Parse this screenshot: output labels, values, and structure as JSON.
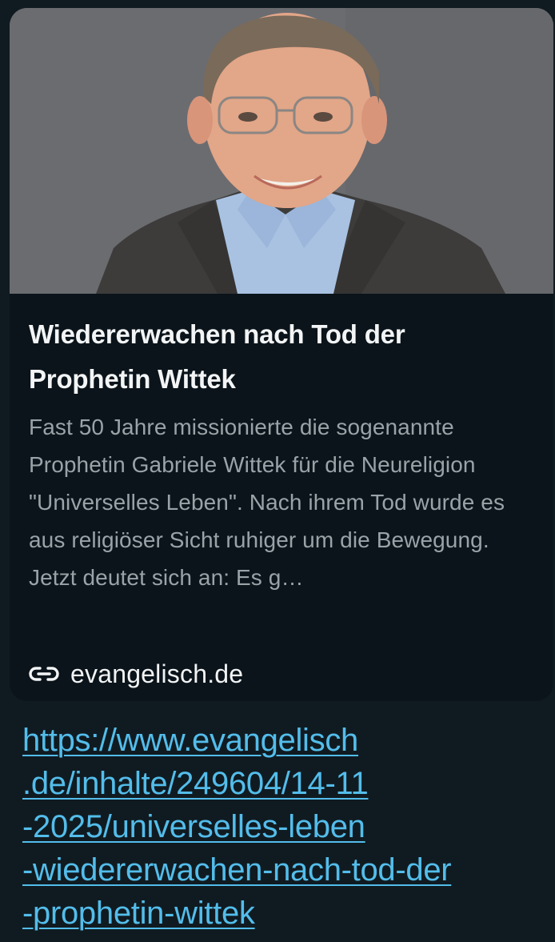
{
  "preview": {
    "image_description_icon": "person-photo",
    "title": "Wiedererwachen nach Tod der Prophetin Wittek",
    "description": "Fast 50 Jahre missionierte die sogenannte Prophetin Gabriele Wittek für die Neureligion \"Universelles Leben\". Nach ihrem Tod wurde es aus religiöser Sicht ruhiger um die Bewegung. Jetzt deutet sich an: Es g…",
    "domain_icon": "link-icon",
    "domain": "evangelisch.de"
  },
  "message": {
    "url_lines": [
      "https://www.evangelisch",
      ".de/inhalte/249604/14-11",
      "-2025/universelles-leben",
      "-wiedererwachen-nach-tod-der",
      "-prophetin-wittek"
    ]
  },
  "colors": {
    "background": "#101b21",
    "card": "#0b141a",
    "title": "#f2f4f5",
    "description": "#9aa3a8",
    "link": "#53bdeb"
  }
}
